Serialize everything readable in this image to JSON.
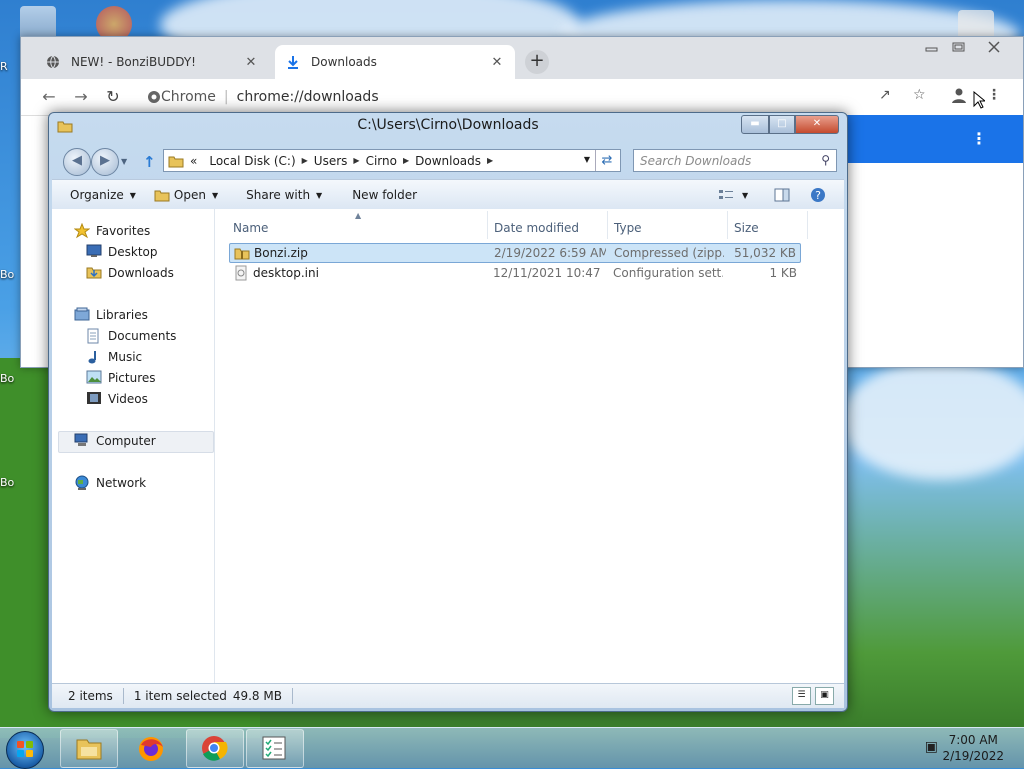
{
  "desktop": {
    "side_labels": [
      "R",
      "Bo",
      "Bo",
      "Bo",
      "Bo"
    ]
  },
  "browser": {
    "tabs": [
      {
        "label": "NEW! - BonziBUDDY!",
        "active": false
      },
      {
        "label": "Downloads",
        "active": true
      }
    ],
    "new_tab": "+",
    "close_glyph": "✕",
    "chip": "Chrome",
    "separator": "|",
    "url": "chrome://downloads",
    "header_color": "#1a73e8"
  },
  "explorer": {
    "title": "C:\\Users\\Cirno\\Downloads",
    "breadcrumb_prefix": "«",
    "breadcrumbs": [
      "Local Disk (C:)",
      "Users",
      "Cirno",
      "Downloads"
    ],
    "search_placeholder": "Search Downloads",
    "toolbar": {
      "organize": "Organize",
      "open": "Open",
      "share_with": "Share with",
      "new_folder": "New folder"
    },
    "nav": {
      "favorites": "Favorites",
      "desktop": "Desktop",
      "downloads": "Downloads",
      "libraries": "Libraries",
      "documents": "Documents",
      "music": "Music",
      "pictures": "Pictures",
      "videos": "Videos",
      "computer": "Computer",
      "network": "Network"
    },
    "columns": [
      "Name",
      "Date modified",
      "Type",
      "Size"
    ],
    "files": [
      {
        "name": "Bonzi.zip",
        "date": "2/19/2022 6:59 AM",
        "type": "Compressed (zipp...",
        "size": "51,032 KB",
        "selected": true
      },
      {
        "name": "desktop.ini",
        "date": "12/11/2021 10:47 ...",
        "type": "Configuration sett...",
        "size": "1 KB",
        "selected": false
      }
    ],
    "status": {
      "count": "2 items",
      "selected": "1 item selected",
      "size": "49.8 MB"
    }
  },
  "taskbar": {
    "time": "7:00 AM",
    "date": "2/19/2022"
  }
}
